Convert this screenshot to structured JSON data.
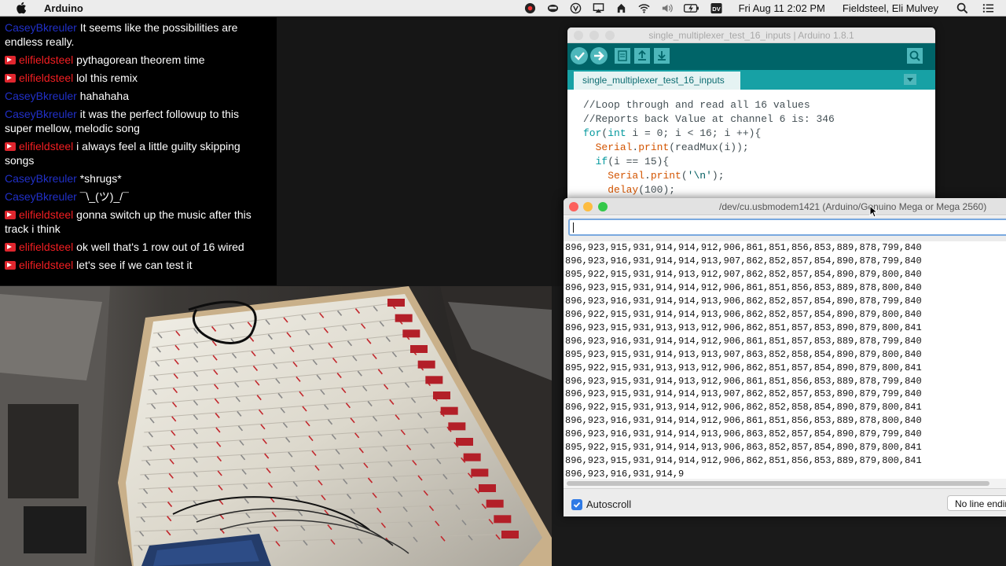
{
  "menubar": {
    "app_name": "Arduino",
    "datetime": "Fri Aug 11  2:02 PM",
    "user": "Fieldsteel, Eli Mulvey",
    "icons": [
      "apple-icon",
      "record-icon",
      "display-icon",
      "vpn-icon",
      "airplay-icon",
      "puzzle-icon",
      "wifi-icon",
      "volume-icon",
      "battery-icon",
      "dv-icon",
      "search-icon",
      "list-icon"
    ],
    "dv_label": "DV"
  },
  "chat": {
    "messages": [
      {
        "user": "CaseyBkreuler",
        "user_color": "#2130c9",
        "badge": false,
        "text": "It seems like the possibilities are endless really."
      },
      {
        "user": "elifieldsteel",
        "user_color": "#f41e22",
        "badge": true,
        "text": "pythagorean theorem time"
      },
      {
        "user": "elifieldsteel",
        "user_color": "#f41e22",
        "badge": true,
        "text": "lol this remix"
      },
      {
        "user": "CaseyBkreuler",
        "user_color": "#2130c9",
        "badge": false,
        "text": "hahahaha"
      },
      {
        "user": "CaseyBkreuler",
        "user_color": "#2130c9",
        "badge": false,
        "text": "it was the perfect followup to this super mellow, melodic song"
      },
      {
        "user": "elifieldsteel",
        "user_color": "#f41e22",
        "badge": true,
        "text": "i always feel a little guilty skipping songs"
      },
      {
        "user": "CaseyBkreuler",
        "user_color": "#2130c9",
        "badge": false,
        "text": "*shrugs*"
      },
      {
        "user": "CaseyBkreuler",
        "user_color": "#2130c9",
        "badge": false,
        "text": "¯\\_(ツ)_/¯"
      },
      {
        "user": "elifieldsteel",
        "user_color": "#f41e22",
        "badge": true,
        "text": "gonna switch up the music after this track i think"
      },
      {
        "user": "elifieldsteel",
        "user_color": "#f41e22",
        "badge": true,
        "text": "ok well that's 1 row out of 16 wired"
      },
      {
        "user": "elifieldsteel",
        "user_color": "#f41e22",
        "badge": true,
        "text": "let's see if we can test it"
      }
    ]
  },
  "ide": {
    "title": "single_multiplexer_test_16_inputs | Arduino 1.8.1",
    "tab": "single_multiplexer_test_16_inputs",
    "toolbar_icons": [
      "verify-icon",
      "upload-icon",
      "new-icon",
      "open-icon",
      "save-icon",
      "serial-monitor-icon",
      "tab-menu-icon"
    ],
    "code_lines": [
      "//Loop through and read all 16 values",
      "//Reports back Value at channel 6 is: 346",
      "for(int i = 0; i < 16; i ++){",
      "  Serial.print(readMux(i));",
      "  if(i == 15){",
      "    Serial.print('\\n');",
      "    delay(100);"
    ]
  },
  "serial": {
    "title": "/dev/cu.usbmodem1421 (Arduino/Genuino Mega or Mega 2560)",
    "input_value": "",
    "lines": [
      "896,923,915,931,914,914,912,906,861,851,856,853,889,878,799,840",
      "896,923,916,931,914,914,913,907,862,852,857,854,890,878,799,840",
      "895,922,915,931,914,913,912,907,862,852,857,854,890,879,800,840",
      "896,923,915,931,914,914,912,906,861,851,856,853,889,878,800,840",
      "896,923,916,931,914,914,913,906,862,852,857,854,890,878,799,840",
      "896,922,915,931,914,914,913,906,862,852,857,854,890,879,800,840",
      "896,923,915,931,913,913,912,906,862,851,857,853,890,879,800,841",
      "896,923,916,931,914,914,912,906,861,851,857,853,889,878,799,840",
      "895,923,915,931,914,913,913,907,863,852,858,854,890,879,800,840",
      "895,922,915,931,913,913,912,906,862,851,857,854,890,879,800,841",
      "896,923,915,931,914,913,912,906,861,851,856,853,889,878,799,840",
      "896,923,915,931,914,914,913,907,862,852,857,853,890,879,799,840",
      "896,922,915,931,913,914,912,906,862,852,858,854,890,879,800,841",
      "896,923,916,931,914,914,912,906,861,851,856,853,889,878,800,840",
      "896,923,916,931,914,914,913,906,863,852,857,854,890,879,799,840",
      "895,922,915,931,914,914,913,906,863,852,857,854,890,879,800,841",
      "896,923,915,931,914,914,912,906,862,851,856,853,889,879,800,841",
      "896,923,916,931,914,9"
    ],
    "autoscroll_label": "Autoscroll",
    "autoscroll_checked": true,
    "line_ending": "No line ending"
  }
}
